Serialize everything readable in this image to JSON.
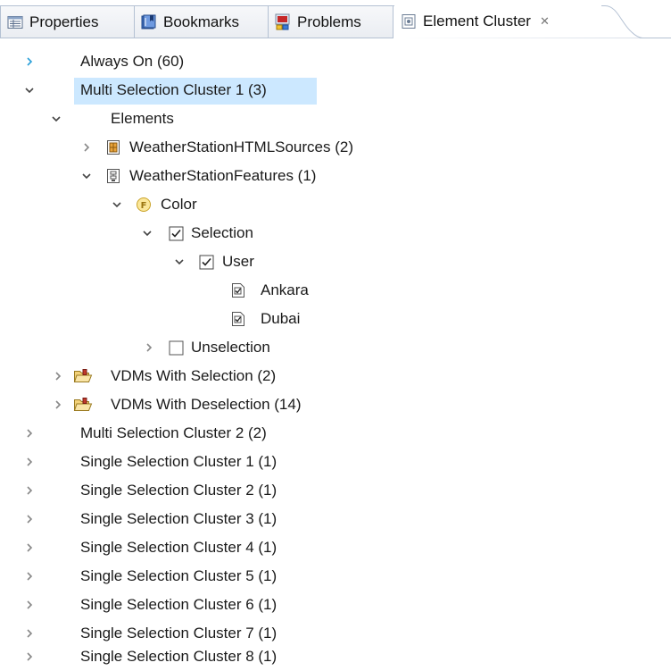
{
  "tabs": [
    {
      "label": "Properties",
      "icon": "properties-icon"
    },
    {
      "label": "Bookmarks",
      "icon": "bookmarks-icon"
    },
    {
      "label": "Problems",
      "icon": "problems-icon"
    },
    {
      "label": "Element Cluster",
      "icon": "element-cluster-icon",
      "active": true,
      "close": "✕"
    }
  ],
  "tree": [
    {
      "label": "Always On (60)",
      "expanded": false,
      "twisty_color": "#2a9fd8"
    },
    {
      "label": "Multi Selection Cluster 1 (3)",
      "expanded": true,
      "selected": true
    },
    {
      "label": "Elements",
      "expanded": true
    },
    {
      "label": "WeatherStationHTMLSources (2)",
      "expanded": false,
      "icon": "html-source-icon"
    },
    {
      "label": "WeatherStationFeatures (1)",
      "expanded": true,
      "icon": "feature-model-icon"
    },
    {
      "label": "Color",
      "expanded": true,
      "icon": "feature-f-icon"
    },
    {
      "label": "Selection",
      "expanded": true,
      "icon": "checkbox-checked-icon"
    },
    {
      "label": "User",
      "expanded": true,
      "icon": "checkbox-checked-icon"
    },
    {
      "label": "Ankara",
      "icon": "config-file-icon"
    },
    {
      "label": "Dubai",
      "icon": "config-file-icon"
    },
    {
      "label": "Unselection",
      "expanded": false,
      "icon": "checkbox-empty-icon"
    },
    {
      "label": "VDMs With Selection (2)",
      "expanded": false,
      "icon": "folder-icon"
    },
    {
      "label": "VDMs With Deselection (14)",
      "expanded": false,
      "icon": "folder-icon"
    },
    {
      "label": "Multi Selection Cluster 2 (2)",
      "expanded": false
    },
    {
      "label": "Single Selection Cluster 1 (1)",
      "expanded": false
    },
    {
      "label": "Single Selection Cluster 2 (1)",
      "expanded": false
    },
    {
      "label": "Single Selection Cluster 3 (1)",
      "expanded": false
    },
    {
      "label": "Single Selection Cluster 4 (1)",
      "expanded": false
    },
    {
      "label": "Single Selection Cluster 5 (1)",
      "expanded": false
    },
    {
      "label": "Single Selection Cluster 6 (1)",
      "expanded": false
    },
    {
      "label": "Single Selection Cluster 7 (1)",
      "expanded": false
    },
    {
      "label": "Single Selection Cluster 8 (1)",
      "expanded": false
    }
  ],
  "colors": {
    "selection": "#cce8ff",
    "tab_border": "#b4c1d3",
    "twisty": "#555555",
    "twisty_hover": "#2a9fd8"
  }
}
